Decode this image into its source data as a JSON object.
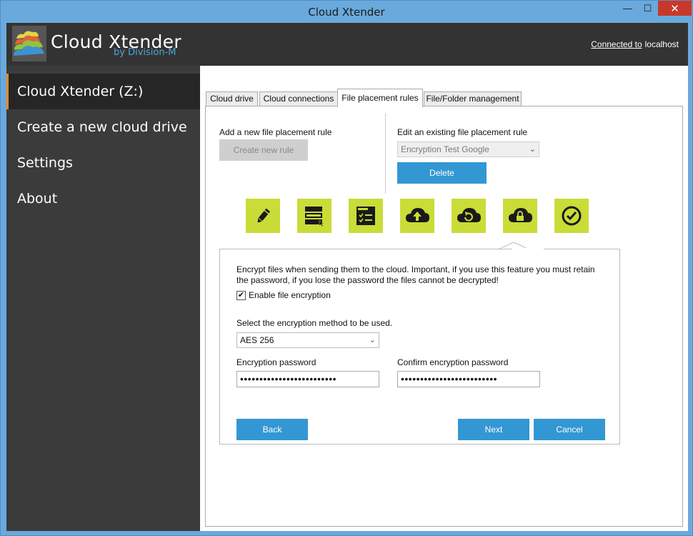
{
  "window": {
    "title": "Cloud Xtender",
    "minimize_glyph": "—",
    "maximize_glyph": "☐",
    "close_glyph": "✕"
  },
  "header": {
    "brand": "Cloud Xtender",
    "brand_sub": "by Division-M",
    "connected_label": "Connected to",
    "connected_host": "localhost"
  },
  "sidebar": {
    "items": [
      {
        "label": "Cloud Xtender (Z:)",
        "active": true
      },
      {
        "label": "Create a new cloud drive",
        "active": false
      },
      {
        "label": "Settings",
        "active": false
      },
      {
        "label": "About",
        "active": false
      }
    ]
  },
  "tabs": [
    {
      "label": "Cloud drive"
    },
    {
      "label": "Cloud connections"
    },
    {
      "label": "File placement rules",
      "active": true
    },
    {
      "label": "File/Folder management"
    }
  ],
  "rules": {
    "add_label": "Add a new file placement rule",
    "create_button": "Create new rule",
    "edit_label": "Edit an existing file placement rule",
    "existing_value": "Encryption Test Google",
    "delete_button": "Delete"
  },
  "steps": [
    {
      "icon": "pencil-icon"
    },
    {
      "icon": "drives-icon"
    },
    {
      "icon": "checklist-icon"
    },
    {
      "icon": "cloud-upload-icon"
    },
    {
      "icon": "cloud-sync-icon"
    },
    {
      "icon": "cloud-lock-icon",
      "active": true
    },
    {
      "icon": "check-circle-icon"
    }
  ],
  "encryption": {
    "description": "Encrypt files when sending them to the cloud. Important, if you use this feature you must retain the password, if you lose the password the files cannot be decrypted!",
    "enable_label": "Enable file encryption",
    "enable_checked": true,
    "check_glyph": "✔",
    "method_label": "Select the encryption method to be used.",
    "method_value": "AES 256",
    "password_label": "Encryption password",
    "password_value": "•••••••••••••••••••••••••",
    "confirm_label": "Confirm encryption password",
    "confirm_value": "•••••••••••••••••••••••••"
  },
  "nav": {
    "back": "Back",
    "next": "Next",
    "cancel": "Cancel"
  },
  "colors": {
    "accent": "#3397d3",
    "step_green": "#c9dc38",
    "active_marker": "#f08a24",
    "header_bg": "#333333",
    "sidebar_bg": "#3b3b3b",
    "close_red": "#c7382b",
    "frame_blue": "#6aa9dc"
  }
}
